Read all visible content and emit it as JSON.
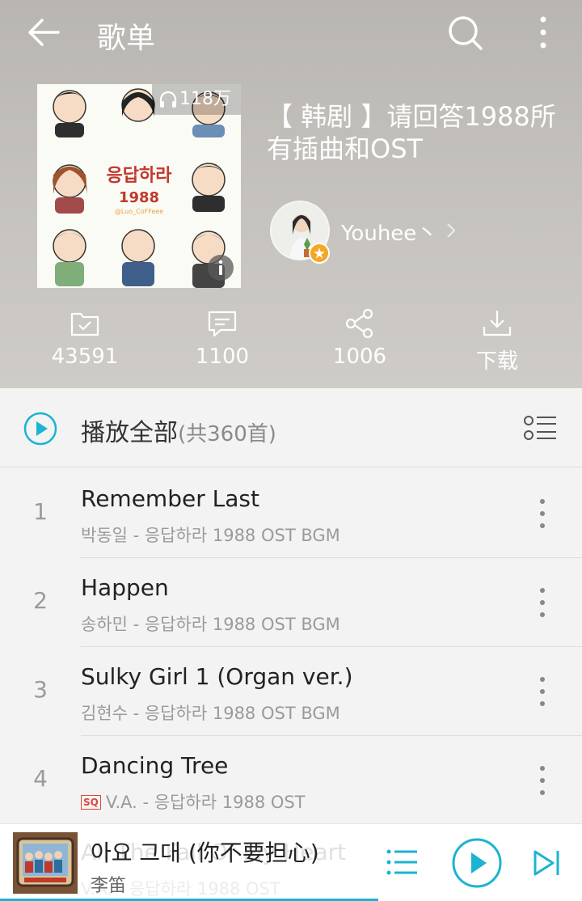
{
  "topbar": {
    "title": "歌单",
    "back_icon": "arrow-left-icon",
    "search_icon": "search-icon",
    "more_icon": "more-vertical-icon"
  },
  "playlist": {
    "play_count": "118万",
    "cover_title": "응답하라",
    "cover_year": "1988",
    "cover_credit": "@Luo_CoFFeee",
    "title": "【 韩剧 】请回答1988所有插曲和OST",
    "creator": "Youhee丶"
  },
  "stats": {
    "collect": "43591",
    "comments": "1100",
    "share": "1006",
    "download": "下载"
  },
  "play_all": {
    "label": "播放全部",
    "count": "(共360首)"
  },
  "songs": [
    {
      "num": "1",
      "title": "Remember Last",
      "sub": "박동일 - 응답하라 1988 OST BGM",
      "badge": ""
    },
    {
      "num": "2",
      "title": "Happen",
      "sub": "송하민 - 응답하라 1988 OST BGM",
      "badge": ""
    },
    {
      "num": "3",
      "title": "Sulky Girl 1 (Organ ver.)",
      "sub": "김현수 - 응답하라 1988 OST BGM",
      "badge": ""
    },
    {
      "num": "4",
      "title": "Dancing Tree",
      "sub": "V.A. - 응답하라 1988 OST",
      "badge": "SQ"
    }
  ],
  "player": {
    "title": "아요 그대 (你不要担心)",
    "artist": "李笛",
    "ghost_title": "All The Fall Of My Heart",
    "ghost_sub": "V.A. - 응답하라 1988 OST",
    "progress": 0.65
  },
  "colors": {
    "accent": "#1bb4d1",
    "header_bg": "#c0bdb8"
  }
}
